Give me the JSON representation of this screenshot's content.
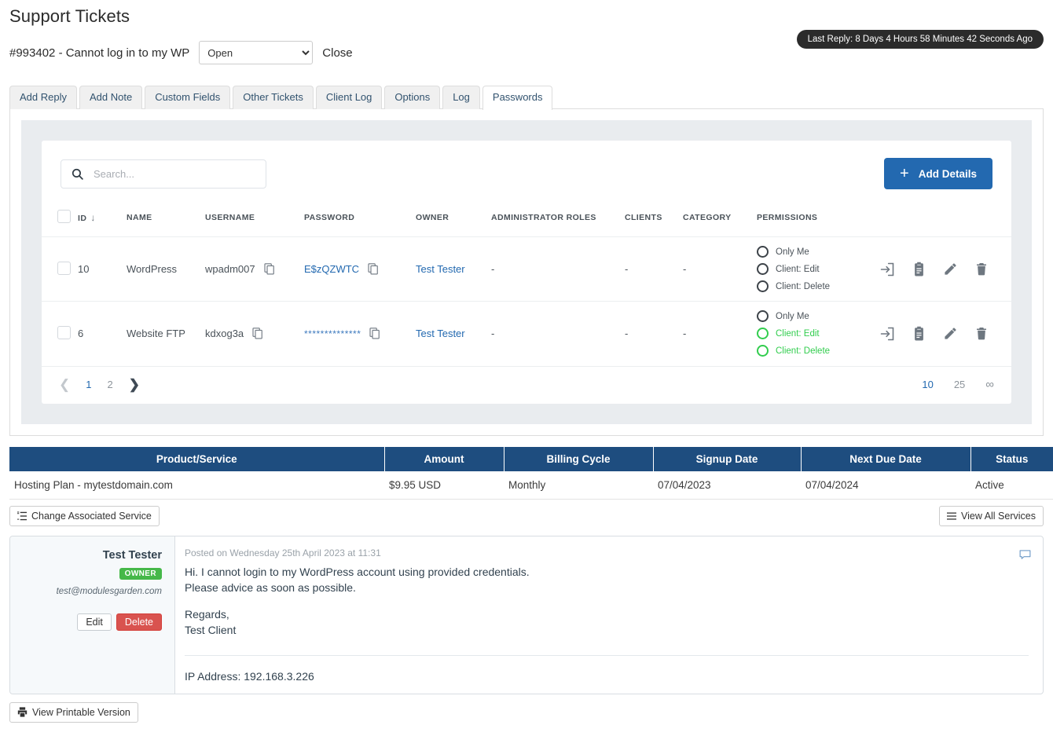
{
  "header": {
    "page_title": "Support Tickets",
    "ticket_subject": "#993402 - Cannot log in to my WP",
    "status_selected": "Open",
    "status_options": [
      "Open"
    ],
    "close_label": "Close",
    "last_reply_badge": "Last Reply: 8 Days 4 Hours 58 Minutes 42 Seconds Ago"
  },
  "tabs": [
    {
      "label": "Add Reply",
      "active": false
    },
    {
      "label": "Add Note",
      "active": false
    },
    {
      "label": "Custom Fields",
      "active": false
    },
    {
      "label": "Other Tickets",
      "active": false
    },
    {
      "label": "Client Log",
      "active": false
    },
    {
      "label": "Options",
      "active": false
    },
    {
      "label": "Log",
      "active": false
    },
    {
      "label": "Passwords",
      "active": true
    }
  ],
  "passwords_panel": {
    "search_placeholder": "Search...",
    "search_value": "",
    "add_button_label": "Add Details",
    "columns": {
      "id": "ID",
      "name": "NAME",
      "username": "USERNAME",
      "password": "PASSWORD",
      "owner": "OWNER",
      "administrator_roles": "ADMINISTRATOR ROLES",
      "clients": "CLIENTS",
      "category": "CATEGORY",
      "permissions": "PERMISSIONS"
    },
    "sort_indicator": "↓",
    "rows": [
      {
        "id": "10",
        "name": "WordPress",
        "username": "wpadm007",
        "password": "E$zQZWTC",
        "owner": "Test Tester",
        "administrator_roles": "-",
        "clients": "-",
        "category": "-",
        "permissions": [
          {
            "label": "Only Me",
            "enabled": false
          },
          {
            "label": "Client: Edit",
            "enabled": false
          },
          {
            "label": "Client: Delete",
            "enabled": false
          }
        ]
      },
      {
        "id": "6",
        "name": "Website FTP",
        "username": "kdxog3a",
        "password": "**************",
        "owner": "Test Tester",
        "administrator_roles": "-",
        "clients": "-",
        "category": "-",
        "permissions": [
          {
            "label": "Only Me",
            "enabled": false
          },
          {
            "label": "Client: Edit",
            "enabled": true
          },
          {
            "label": "Client: Delete",
            "enabled": true
          }
        ]
      }
    ],
    "pagination": {
      "pages": [
        "1",
        "2"
      ],
      "active_page": "1",
      "page_sizes": [
        "10",
        "25",
        "∞"
      ],
      "active_page_size": "10"
    }
  },
  "service_table": {
    "columns": [
      "Product/Service",
      "Amount",
      "Billing Cycle",
      "Signup Date",
      "Next Due Date",
      "Status"
    ],
    "row": {
      "product": "Hosting Plan - mytestdomain.com",
      "amount": "$9.95 USD",
      "billing_cycle": "Monthly",
      "signup_date": "07/04/2023",
      "next_due_date": "07/04/2024",
      "status": "Active"
    },
    "change_service_label": "Change Associated Service",
    "view_all_services_label": "View All Services"
  },
  "message": {
    "author": "Test Tester",
    "badge": "OWNER",
    "email": "test@modulesgarden.com",
    "edit_label": "Edit",
    "delete_label": "Delete",
    "posted_on": "Posted on Wednesday 25th April 2023 at 11:31",
    "body_line1": "Hi. I cannot login to my WordPress account using provided credentials.",
    "body_line2": "Please advice as soon as possible.",
    "body_line3": "Regards,",
    "body_line4": "Test Client",
    "ip_address": "IP Address: 192.168.3.226"
  },
  "footer": {
    "printable_label": "View Printable Version"
  },
  "colors": {
    "accent_blue": "#2369b0",
    "navy_header": "#1e4d7f",
    "green": "#32cd4e",
    "badge_green": "#45b849",
    "danger_red": "#d9534f",
    "dark_badge": "#2b2b2b"
  }
}
